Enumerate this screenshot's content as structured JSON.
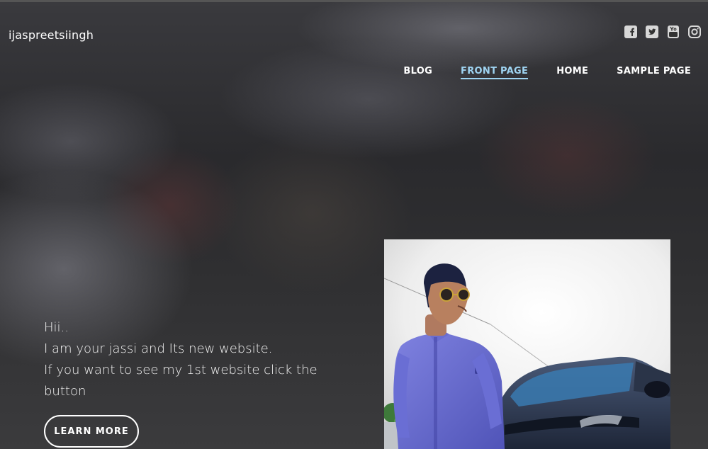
{
  "site": {
    "title": "ijaspreetsiingh"
  },
  "social": [
    {
      "icon": "facebook-icon"
    },
    {
      "icon": "twitter-icon"
    },
    {
      "icon": "youtube-icon"
    },
    {
      "icon": "instagram-icon"
    }
  ],
  "nav": {
    "items": [
      {
        "label": "BLOG",
        "active": false
      },
      {
        "label": "FRONT PAGE",
        "active": true
      },
      {
        "label": "HOME",
        "active": false
      },
      {
        "label": "SAMPLE PAGE",
        "active": false
      }
    ],
    "active_color": "#9fd4f2"
  },
  "intro": {
    "line1": "Hii..",
    "line2": "I am your jassi and Its new website.",
    "line3": "If you want to see my 1st website click the button"
  },
  "cta": {
    "label": "LEARN MORE"
  }
}
